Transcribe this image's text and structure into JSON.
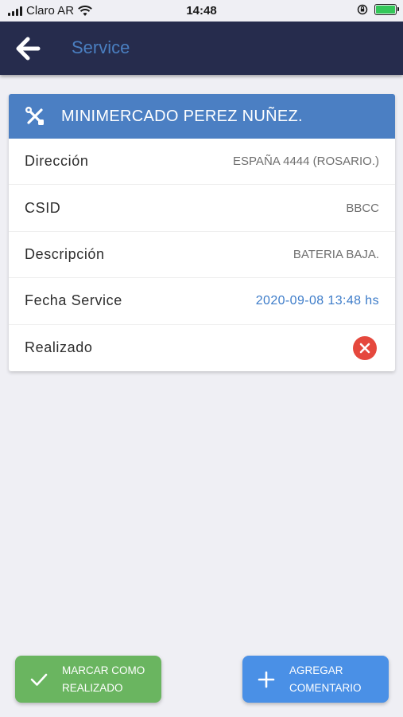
{
  "status_bar": {
    "carrier": "Claro AR",
    "time": "14:48"
  },
  "nav": {
    "title": "Service",
    "back_icon": "arrow-left-icon"
  },
  "card": {
    "title": "MINIMERCADO PEREZ NUÑEZ.",
    "header_icon": "tools-icon",
    "header_color": "#4b7fc3",
    "rows": [
      {
        "label": "Dirección",
        "value": "ESPAÑA 4444 (ROSARIO.)"
      },
      {
        "label": "CSID",
        "value": "BBCC"
      },
      {
        "label": "Descripción",
        "value": "BATERIA BAJA."
      },
      {
        "label": "Fecha Service",
        "value": "2020-09-08 13:48 hs"
      },
      {
        "label": "Realizado",
        "status_icon": "close-circle-icon",
        "status_color": "#e5483d"
      }
    ]
  },
  "actions": {
    "mark_done": {
      "line1": "MARCAR COMO",
      "line2": "REALIZADO",
      "icon": "check-icon",
      "color": "#6ab560"
    },
    "add_comment": {
      "line1": "AGREGAR",
      "line2": "COMENTARIO",
      "icon": "plus-icon",
      "color": "#4a90e6"
    }
  }
}
